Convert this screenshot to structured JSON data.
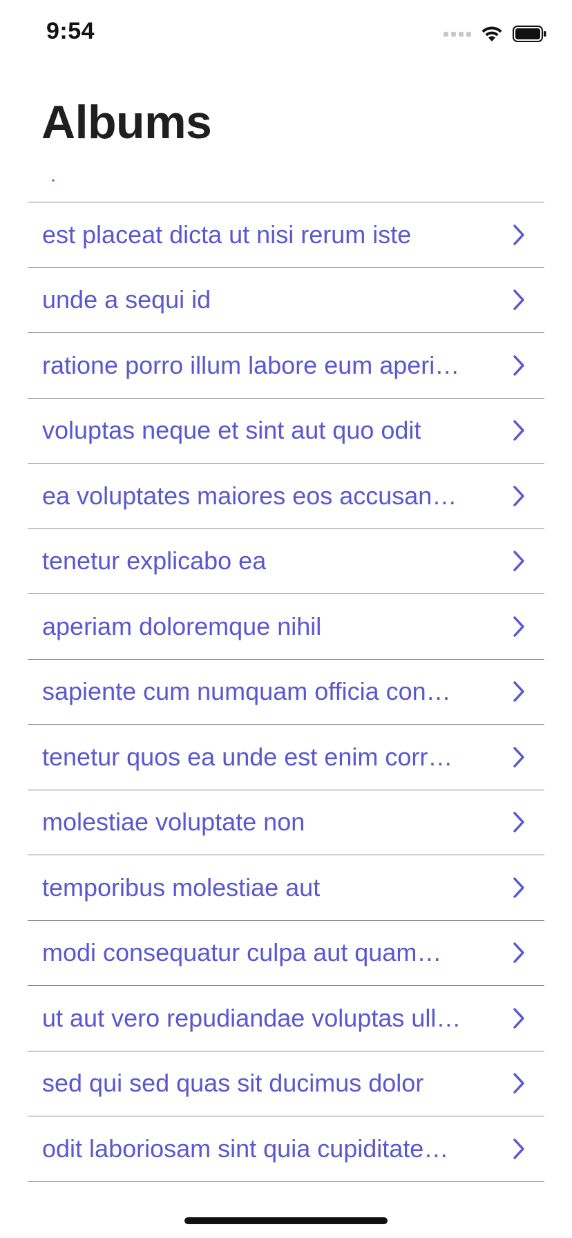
{
  "status_bar": {
    "time": "9:54"
  },
  "nav": {
    "title": "Albums"
  },
  "colors": {
    "accent": "#5a57d0",
    "separator": "#8a8a8a"
  },
  "list": {
    "peek_label": "qui est esse",
    "items": [
      {
        "label": "est placeat dicta ut nisi rerum iste"
      },
      {
        "label": "unde a sequi id"
      },
      {
        "label": "ratione porro illum labore eum aperi…"
      },
      {
        "label": "voluptas neque et sint aut quo odit"
      },
      {
        "label": "ea voluptates maiores eos accusan…"
      },
      {
        "label": "tenetur explicabo ea"
      },
      {
        "label": "aperiam doloremque nihil"
      },
      {
        "label": "sapiente cum numquam officia con…"
      },
      {
        "label": "tenetur quos ea unde est enim corr…"
      },
      {
        "label": "molestiae voluptate non"
      },
      {
        "label": "temporibus molestiae aut"
      },
      {
        "label": "modi consequatur culpa aut quam…"
      },
      {
        "label": "ut aut vero repudiandae voluptas ull…"
      },
      {
        "label": "sed qui sed quas sit ducimus dolor"
      },
      {
        "label": "odit laboriosam sint quia cupiditate…"
      }
    ]
  }
}
